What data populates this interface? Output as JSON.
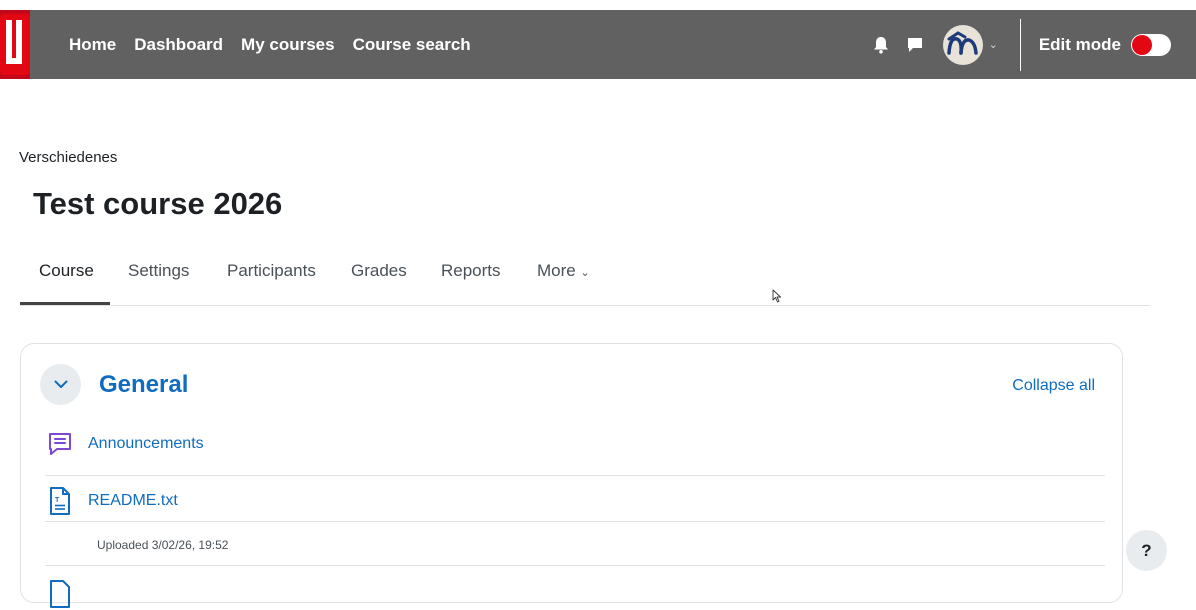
{
  "navbar": {
    "links": [
      "Home",
      "Dashboard",
      "My courses",
      "Course search"
    ],
    "edit_mode_label": "Edit mode",
    "edit_mode_on": false,
    "icons": [
      "bell-icon",
      "chat-bubble-icon",
      "user-avatar",
      "chevron-down-icon"
    ]
  },
  "breadcrumb": "Verschiedenes",
  "page_title": "Test course 2026",
  "tabs": [
    {
      "label": "Course",
      "active": true
    },
    {
      "label": "Settings"
    },
    {
      "label": "Participants"
    },
    {
      "label": "Grades"
    },
    {
      "label": "Reports"
    },
    {
      "label": "More"
    }
  ],
  "section": {
    "title": "General",
    "collapse_all_label": "Collapse all",
    "activities": [
      {
        "name": "Announcements",
        "icon": "forum-icon"
      },
      {
        "name": "README.txt",
        "icon": "text-file-icon",
        "meta": "Uploaded 3/02/26, 19:52"
      }
    ]
  },
  "help_label": "?",
  "colors": {
    "navbar_bg": "#616161",
    "link": "#0f6cbf",
    "forum_icon": "#7e48d4",
    "file_icon": "#0f6cbf",
    "toggle_knob": "#e30613"
  }
}
